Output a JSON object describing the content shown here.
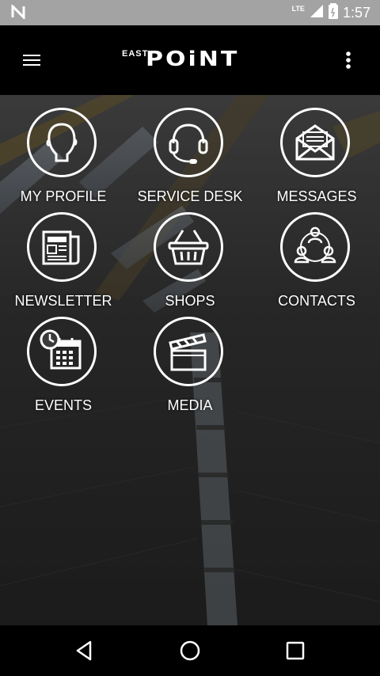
{
  "status_bar": {
    "time": "1:57",
    "network": "LTE",
    "icons": [
      "notification-n-icon",
      "signal-icon",
      "battery-icon"
    ]
  },
  "app_bar": {
    "logo_small": "EAST",
    "logo_big": "POiNT",
    "menu_icon": "hamburger-menu-icon",
    "more_icon": "overflow-menu-icon"
  },
  "tiles": [
    {
      "label": "MY PROFILE",
      "icon": "profile-head-icon"
    },
    {
      "label": "SERVICE DESK",
      "icon": "headset-icon"
    },
    {
      "label": "MESSAGES",
      "icon": "envelope-icon"
    },
    {
      "label": "NEWSLETTER",
      "icon": "newspaper-icon"
    },
    {
      "label": "SHOPS",
      "icon": "basket-icon"
    },
    {
      "label": "CONTACTS",
      "icon": "people-network-icon"
    },
    {
      "label": "EVENTS",
      "icon": "calendar-clock-icon"
    },
    {
      "label": "MEDIA",
      "icon": "clapperboard-icon"
    }
  ],
  "nav_bar": {
    "buttons": [
      "back-icon",
      "home-icon",
      "recents-icon"
    ]
  },
  "colors": {
    "status_bar": "#a3a3a3",
    "app_bar": "#000000",
    "icon_stroke": "#ffffff"
  }
}
